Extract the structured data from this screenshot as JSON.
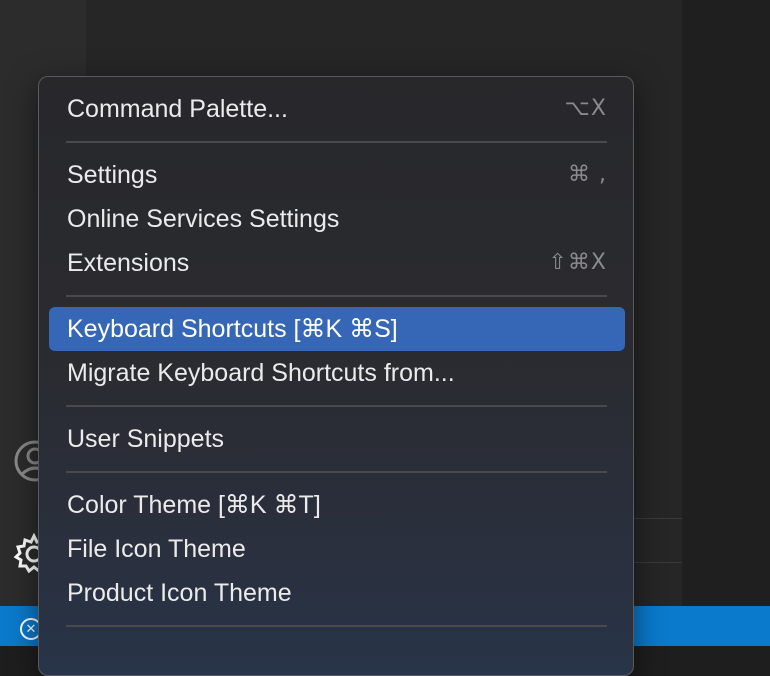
{
  "menu": {
    "items": [
      {
        "label": "Command Palette...",
        "shortcut": "⌥X"
      },
      {
        "label": "Settings",
        "shortcut": "⌘ ,"
      },
      {
        "label": "Online Services Settings",
        "shortcut": ""
      },
      {
        "label": "Extensions",
        "shortcut": "⇧⌘X"
      },
      {
        "label": "Keyboard Shortcuts [⌘K ⌘S]",
        "shortcut": "",
        "selected": true
      },
      {
        "label": "Migrate Keyboard Shortcuts from...",
        "shortcut": ""
      },
      {
        "label": "User Snippets",
        "shortcut": ""
      },
      {
        "label": "Color Theme [⌘K ⌘T]",
        "shortcut": ""
      },
      {
        "label": "File Icon Theme",
        "shortcut": ""
      },
      {
        "label": "Product Icon Theme",
        "shortcut": ""
      }
    ]
  },
  "icons": {
    "account": "account-icon",
    "manage": "gear-icon",
    "status": "close-circle-icon"
  },
  "colors": {
    "selection": "#3567b6",
    "status_bar": "#0a7acc"
  }
}
